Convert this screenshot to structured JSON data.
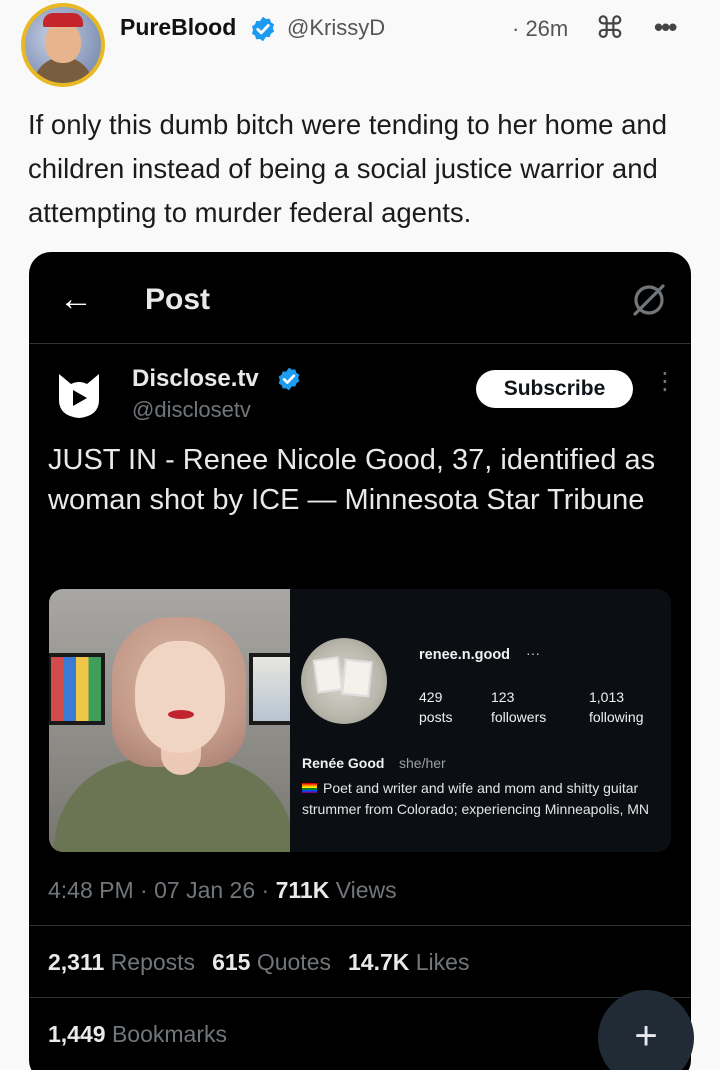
{
  "author": {
    "display_name": "PureBlood",
    "handle": "@KrissyD",
    "time": "· 26m",
    "cmd_glyph": "⌘",
    "more_glyph": "•••"
  },
  "tweet": {
    "text": "If only this dumb bitch were tending to her home and children instead of being a social justice warrior and attempting to murder federal agents."
  },
  "screenshot": {
    "nav": {
      "back_glyph": "←",
      "title": "Post"
    },
    "source": {
      "name": "Disclose.tv",
      "handle": "@disclosetv",
      "subscribe_label": "Subscribe",
      "more_glyph": "⋮"
    },
    "post_text": "JUST IN - Renee Nicole Good, 37, identified as woman shot by ICE — Minnesota Star Tribune",
    "instagram": {
      "username": "renee.n.good",
      "dots": "···",
      "stats": [
        {
          "value": "429",
          "label": "posts"
        },
        {
          "value": "123",
          "label": "followers"
        },
        {
          "value": "1,013",
          "label": "following"
        }
      ],
      "name": "Renée Good",
      "pronouns": "she/her",
      "bio": "Poet and writer and wife and mom and shitty guitar strummer from Colorado; experiencing Minneapolis, MN"
    },
    "meta": {
      "time": "4:48 PM",
      "date": "07 Jan 26",
      "views_count": "711K",
      "views_label": "Views"
    },
    "stats": {
      "reposts_count": "2,311",
      "reposts_label": "Reposts",
      "quotes_count": "615",
      "quotes_label": "Quotes",
      "likes_count": "14.7K",
      "likes_label": "Likes",
      "bookmarks_count": "1,449",
      "bookmarks_label": "Bookmarks"
    }
  },
  "fab": {
    "glyph": "+"
  },
  "colors": {
    "verified_blue": "#1d9bf0",
    "avatar_ring": "#e8b923",
    "dark_bg": "#000000"
  },
  "icons": [
    "verified-badge-icon",
    "command-key-icon",
    "more-icon",
    "back-arrow-icon",
    "grok-icon",
    "disclose-logo-icon",
    "compose-plus-icon"
  ]
}
